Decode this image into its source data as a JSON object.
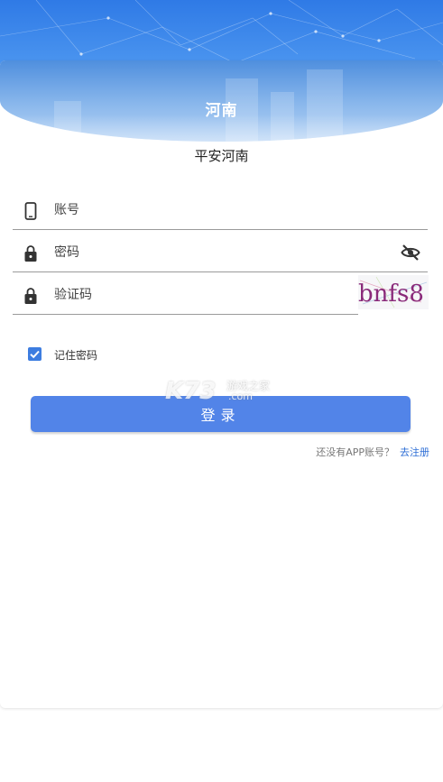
{
  "header": {
    "title": "河南",
    "subtitle": "平安河南"
  },
  "form": {
    "account": {
      "placeholder": "账号",
      "icon": "phone-icon"
    },
    "password": {
      "placeholder": "密码",
      "icon": "lock-icon",
      "toggle_icon": "eye-off-icon"
    },
    "captcha": {
      "placeholder": "验证码",
      "icon": "lock-icon",
      "image_text": "bnfs8"
    },
    "remember": {
      "label": "记住密码",
      "checked": true
    },
    "login_label": "登录"
  },
  "footer": {
    "no_account_text": "还没有APP账号？",
    "register_link": "去注册"
  },
  "watermark": {
    "logo": "K73",
    "cn": "游戏之家",
    "domain": ".com"
  },
  "colors": {
    "primary": "#5284e8",
    "header": "#2f7ae6",
    "link": "#2f6fd6"
  }
}
